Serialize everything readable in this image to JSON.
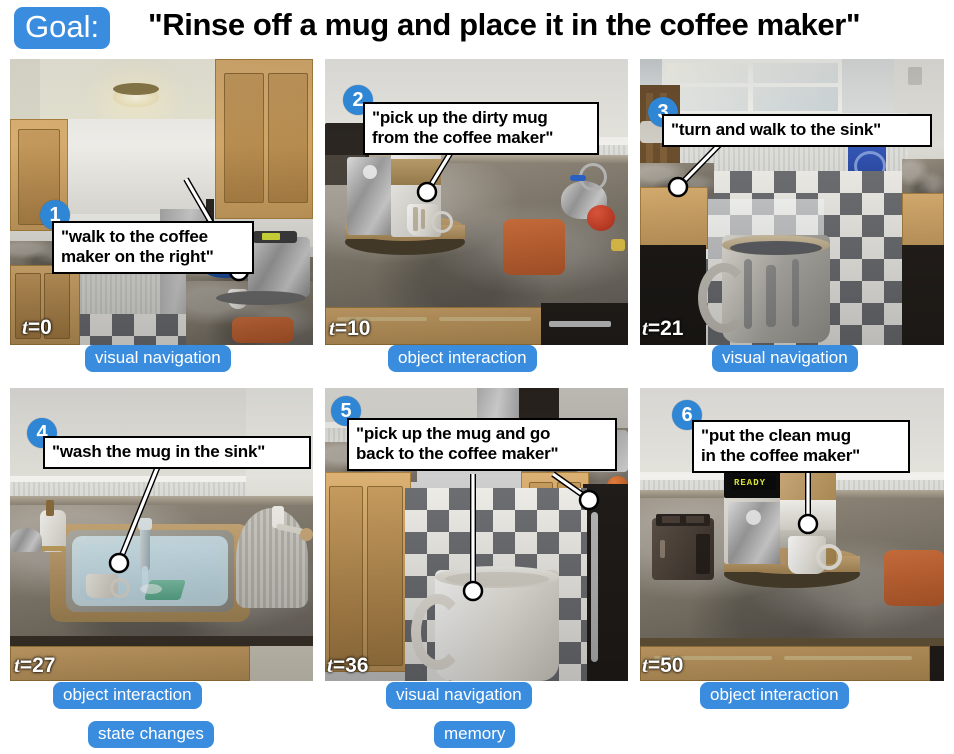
{
  "header": {
    "goal_label": "Goal:",
    "goal_text": "\"Rinse off a mug and place it in the coffee maker\""
  },
  "panels": [
    {
      "index": "1",
      "instruction": "\"walk to the coffee\nmaker on the right\"",
      "timestep_prefix": "t",
      "timestep_value": "=0",
      "tags": [
        "visual navigation"
      ],
      "scene_name": "kitchen-hallway-view"
    },
    {
      "index": "2",
      "instruction": "\"pick up the dirty mug\nfrom the coffee maker\"",
      "timestep_prefix": "t",
      "timestep_value": "=10",
      "tags": [
        "object interaction"
      ],
      "scene_name": "countertop-coffee-maker-dirty-mug"
    },
    {
      "index": "3",
      "instruction": "\"turn and walk to the sink\"",
      "timestep_prefix": "t",
      "timestep_value": "=21",
      "tags": [
        "visual navigation"
      ],
      "scene_name": "kitchen-floor-carrying-dirty-mug"
    },
    {
      "index": "4",
      "instruction": "\"wash the mug in the sink\"",
      "timestep_prefix": "t",
      "timestep_value": "=27",
      "tags": [
        "object interaction",
        "state changes"
      ],
      "scene_name": "sink-washing-mug"
    },
    {
      "index": "5",
      "instruction": "\"pick up the mug and go\nback to the coffee maker\"",
      "timestep_prefix": "t",
      "timestep_value": "=36",
      "tags": [
        "visual navigation",
        "memory"
      ],
      "scene_name": "kitchen-floor-carrying-clean-mug"
    },
    {
      "index": "6",
      "instruction": "\"put the clean mug\nin the coffee maker\"",
      "timestep_prefix": "t",
      "timestep_value": "=50",
      "tags": [
        "object interaction"
      ],
      "scene_name": "countertop-coffee-maker-clean-mug"
    }
  ],
  "scene_labels": {
    "coffee_maker_display": "READY"
  },
  "colors": {
    "badge_blue": "#3a8dde",
    "number_badge_blue": "#2f86d4",
    "bubble_fill": "#ffffff",
    "bubble_border": "#000000",
    "tag_text": "#ffffff",
    "timestamp_text": "#ffffff",
    "led_text": "#d8e23a"
  }
}
